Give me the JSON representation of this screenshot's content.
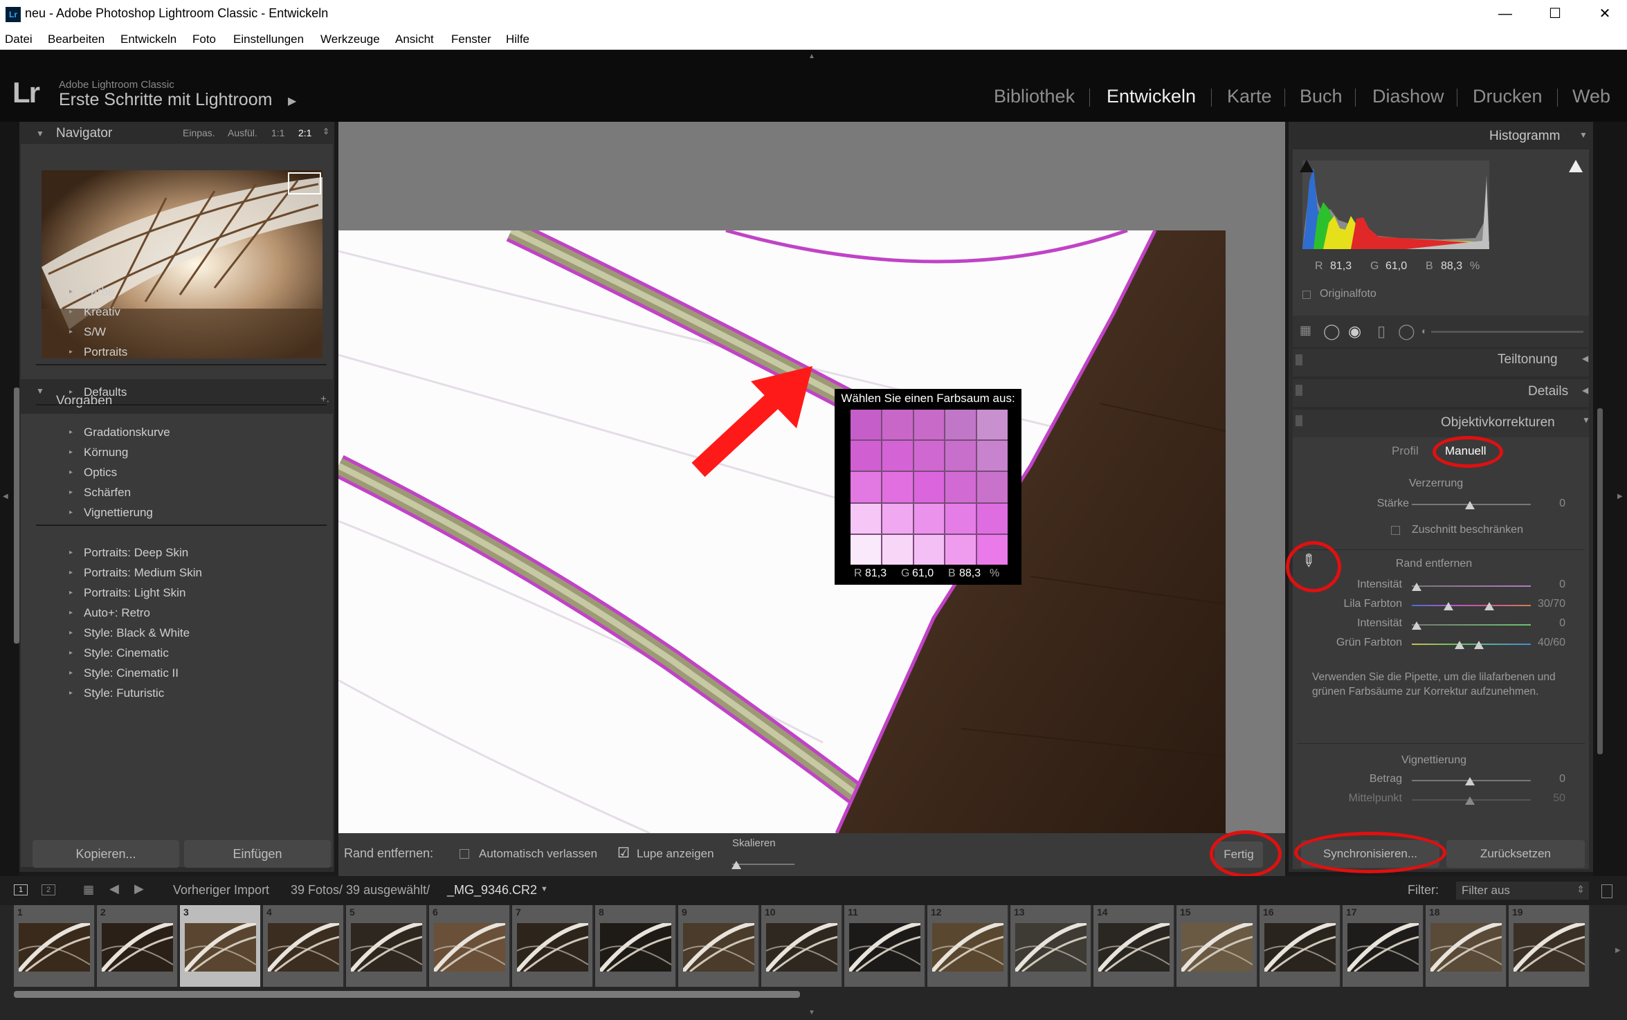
{
  "window": {
    "title": "neu - Adobe Photoshop Lightroom Classic - Entwickeln",
    "app_icon": "Lr",
    "controls": [
      "—",
      "☐",
      "✕"
    ]
  },
  "menu": [
    "Datei",
    "Bearbeiten",
    "Entwickeln",
    "Foto",
    "Einstellungen",
    "Werkzeuge",
    "Ansicht",
    "Fenster",
    "Hilfe"
  ],
  "identity": {
    "logo": "Lr",
    "app_name": "Adobe Lightroom Classic",
    "catalog": "Erste Schritte mit Lightroom"
  },
  "modules": [
    {
      "label": "Bibliothek",
      "active": false
    },
    {
      "label": "Entwickeln",
      "active": true
    },
    {
      "label": "Karte",
      "active": false
    },
    {
      "label": "Buch",
      "active": false
    },
    {
      "label": "Diashow",
      "active": false
    },
    {
      "label": "Drucken",
      "active": false
    },
    {
      "label": "Web",
      "active": false
    }
  ],
  "navigator": {
    "title": "Navigator",
    "zoom_options": [
      "Einpas.",
      "Ausfül.",
      "1:1",
      "2:1"
    ],
    "active_zoom": "2:1"
  },
  "presets": {
    "title": "Vorgaben",
    "add": "+.",
    "groups": [
      [
        "Farbe",
        "Kreativ",
        "S/W",
        "Portraits"
      ],
      [
        "Defaults"
      ],
      [
        "Gradationskurve",
        "Körnung",
        "Optics",
        "Schärfen",
        "Vignettierung"
      ],
      [
        "Portraits: Deep Skin",
        "Portraits: Medium Skin",
        "Portraits: Light Skin",
        "Auto+: Retro",
        "Style: Black & White",
        "Style: Cinematic",
        "Style: Cinematic II",
        "Style: Futuristic"
      ]
    ]
  },
  "left_buttons": {
    "copy": "Kopieren...",
    "paste": "Einfügen"
  },
  "loupe": {
    "title": "Wählen Sie einen Farbsaum aus:",
    "r_label": "R",
    "r": "81,3",
    "g_label": "G",
    "g": "61,0",
    "b_label": "B",
    "b": "88,3",
    "unit": "%",
    "swatches": [
      "#c55ec8",
      "#c967c9",
      "#c76ac8",
      "#c077c7",
      "#c990d0",
      "#d05fd2",
      "#d463d5",
      "#d068d1",
      "#c86ecb",
      "#c783cd",
      "#e278e2",
      "#e16fe0",
      "#db65dc",
      "#d16ad3",
      "#c872cb",
      "#f5c6f6",
      "#f0a9f1",
      "#eb92ec",
      "#e57de7",
      "#de6de1",
      "#fae8fb",
      "#f7d6f8",
      "#f3bff4",
      "#ef9cef",
      "#ea79ea"
    ]
  },
  "toolbar": {
    "label": "Rand entfernen:",
    "auto_leave": "Automatisch verlassen",
    "auto_leave_checked": false,
    "show_loupe": "Lupe anzeigen",
    "show_loupe_checked": true,
    "scale": "Skalieren",
    "done": "Fertig"
  },
  "histogram": {
    "title": "Histogramm",
    "r_label": "R",
    "r": "81,3",
    "g_label": "G",
    "g": "61,0",
    "b_label": "B",
    "b": "88,3",
    "unit": "%",
    "original_photo": "Originalfoto"
  },
  "panels": {
    "split_toning": "Teiltonung",
    "details": "Details",
    "lens_corrections": "Objektivkorrekturen"
  },
  "lens": {
    "tab_profile": "Profil",
    "tab_manual": "Manuell",
    "distortion": {
      "title": "Verzerrung",
      "amount_label": "Stärke",
      "amount": "0",
      "constrain_crop": "Zuschnitt beschränken"
    },
    "defringe": {
      "title": "Rand entfernen",
      "purple_amount_label": "Intensität",
      "purple_amount": "0",
      "purple_hue_label": "Lila Farbton",
      "purple_hue": "30/70",
      "green_amount_label": "Intensität",
      "green_amount": "0",
      "green_hue_label": "Grün Farbton",
      "green_hue": "40/60",
      "hint": "Verwenden Sie die Pipette, um die lilafarbenen und grünen Farbsäume zur Korrektur aufzunehmen."
    },
    "vignetting": {
      "title": "Vignettierung",
      "amount_label": "Betrag",
      "amount": "0",
      "midpoint_label": "Mittelpunkt",
      "midpoint": "50"
    }
  },
  "right_buttons": {
    "sync": "Synchronisieren...",
    "reset": "Zurücksetzen"
  },
  "filmstrip": {
    "source": "Vorheriger Import",
    "count": "39 Fotos/ 39 ausgewählt/",
    "filename": "_MG_9346.CR2",
    "filter_label": "Filter:",
    "filter_value": "Filter aus",
    "selected": 3,
    "numbers": [
      "1",
      "2",
      "3",
      "4",
      "5",
      "6",
      "7",
      "8",
      "9",
      "10",
      "11",
      "12",
      "13",
      "14",
      "15",
      "16",
      "17",
      "18",
      "19"
    ]
  },
  "annotations": {
    "arrow_color": "#ff1a1a",
    "ring_color": "#e01010"
  }
}
